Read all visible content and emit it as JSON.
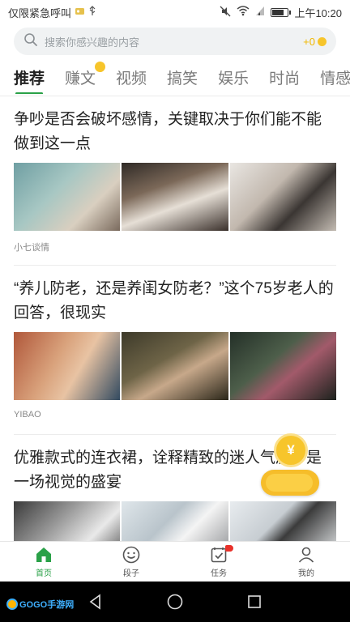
{
  "status_bar": {
    "left_text": "仅限紧急呼叫",
    "time": "上午10:20",
    "icons": [
      "sim-icon",
      "usb-icon",
      "mute-icon",
      "wifi-icon",
      "signal-icon",
      "battery-icon"
    ]
  },
  "search": {
    "placeholder": "搜索你感兴趣的内容",
    "coin_count": "+0"
  },
  "tabs": [
    "推荐",
    "赚文",
    "视频",
    "搞笑",
    "娱乐",
    "时尚",
    "情感"
  ],
  "active_tab_index": 0,
  "articles": [
    {
      "title": "争吵是否会破坏感情，关键取决于你们能不能做到这一点",
      "source": "小七谈情",
      "image_count": 3
    },
    {
      "title": "“养儿防老，还是养闺女防老？”这个75岁老人的回答，很现实",
      "source": "YIBAO",
      "image_count": 3
    },
    {
      "title": "优雅款式的连衣裙，诠释精致的迷人气质，是一场视觉的盛宴",
      "source": "",
      "image_count": 3
    }
  ],
  "floating_coin": {
    "symbol": "¥"
  },
  "bottom_nav": [
    {
      "label": "首页",
      "icon": "home-icon",
      "active": true,
      "badge": false
    },
    {
      "label": "段子",
      "icon": "smiley-icon",
      "active": false,
      "badge": true
    },
    {
      "label": "任务",
      "icon": "task-icon",
      "active": false,
      "badge": true
    },
    {
      "label": "我的",
      "icon": "profile-icon",
      "active": false,
      "badge": false
    }
  ],
  "watermark": {
    "text": "GOGO手游网"
  },
  "colors": {
    "accent_green": "#2aa148",
    "coin_yellow": "#f7c52b",
    "badge_red": "#e8312a"
  }
}
